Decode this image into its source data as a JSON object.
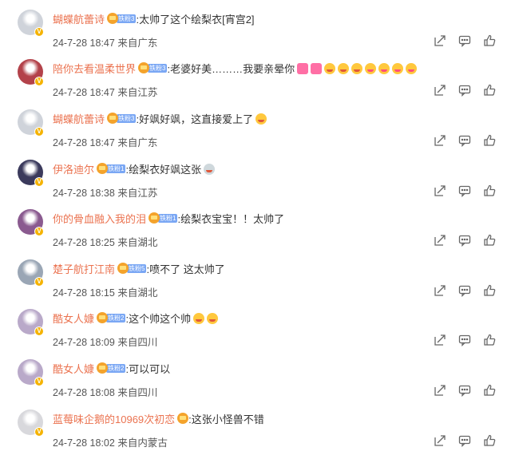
{
  "comments": [
    {
      "username": "蝴蝶航蕾诗",
      "fan_badge": "铁粉3",
      "text": ":太帅了这个绘梨衣[宵宫2]",
      "emojis": [],
      "time": "24-7-28 18:47",
      "location": "来自广东",
      "avatar_color": "#cfd3da"
    },
    {
      "username": "陪你去看温柔世界",
      "fan_badge": "铁粉3",
      "text": ":老婆好美………我要亲晕你",
      "emojis": [
        "heart",
        "heart",
        "smile",
        "smile",
        "smile",
        "kiss",
        "kiss",
        "kiss",
        "kiss"
      ],
      "time": "24-7-28 18:47",
      "location": "来自江苏",
      "avatar_color": "#b3424a"
    },
    {
      "username": "蝴蝶航蕾诗",
      "fan_badge": "铁粉3",
      "text": ":好飒好飒，这直接爱上了",
      "emojis": [
        "smile"
      ],
      "time": "24-7-28 18:47",
      "location": "来自广东",
      "avatar_color": "#cfd3da"
    },
    {
      "username": "伊洛迪尔",
      "fan_badge": "铁粉1",
      "text": ":绘梨衣好飒这张",
      "emojis": [
        "grey"
      ],
      "time": "24-7-28 18:38",
      "location": "来自江苏",
      "avatar_color": "#3b3a5c"
    },
    {
      "username": "你的骨血融入我的泪",
      "fan_badge": "铁粉1",
      "text": ":绘梨衣宝宝！！太帅了",
      "emojis": [],
      "time": "24-7-28 18:25",
      "location": "来自湖北",
      "avatar_color": "#8a5a8f"
    },
    {
      "username": "楚子航打江南",
      "fan_badge": "铁粉5",
      "text": ":喷不了 这太帅了",
      "emojis": [],
      "time": "24-7-28 18:15",
      "location": "来自湖北",
      "avatar_color": "#9aa6b5"
    },
    {
      "username": "酷女人嫝",
      "fan_badge": "铁粉2",
      "text": ":这个帅这个帅",
      "emojis": [
        "smile",
        "smile"
      ],
      "time": "24-7-28 18:09",
      "location": "来自四川",
      "avatar_color": "#b9a9c9"
    },
    {
      "username": "酷女人嫝",
      "fan_badge": "铁粉2",
      "text": ":可以可以",
      "emojis": [],
      "time": "24-7-28 18:08",
      "location": "来自四川",
      "avatar_color": "#b9a9c9"
    },
    {
      "username": "蓝莓味企鹅的10969次初恋",
      "fan_badge": "",
      "text": ":这张小怪兽不错",
      "emojis": [],
      "time": "24-7-28 18:02",
      "location": "来自内蒙古",
      "avatar_color": "#d8d8dc"
    }
  ],
  "accent": "#eb7350"
}
